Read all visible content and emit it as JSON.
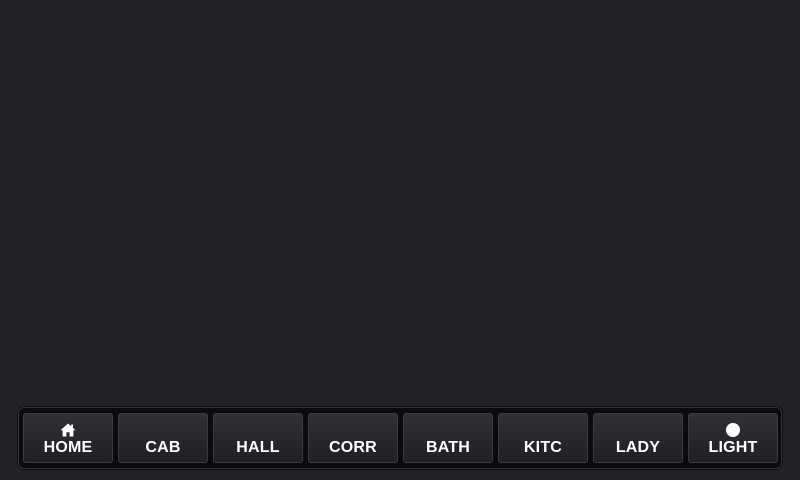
{
  "nav": {
    "items": [
      {
        "label": "HOME",
        "icon": "home-icon"
      },
      {
        "label": "CAB"
      },
      {
        "label": "HALL"
      },
      {
        "label": "CORR"
      },
      {
        "label": "BATH"
      },
      {
        "label": "KITC"
      },
      {
        "label": "LADY"
      },
      {
        "label": "LIGHT",
        "icon": "circle-icon"
      }
    ]
  },
  "colors": {
    "background": "#222328",
    "bar": "#0b0b0d",
    "button": "#2a2b30",
    "text": "#ffffff"
  }
}
